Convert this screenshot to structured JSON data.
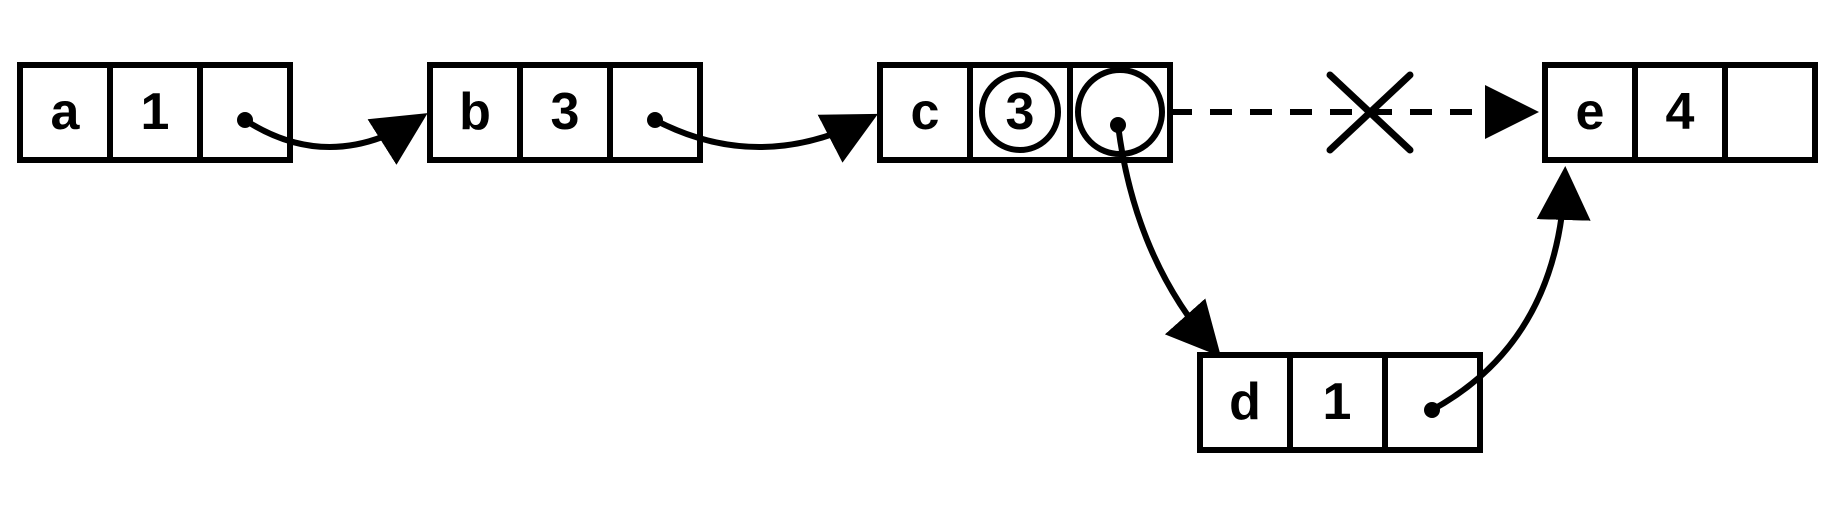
{
  "chart_data": {
    "type": "diagram",
    "description": "Singly linked list with an insertion: original link c→e is cancelled (dashed, crossed out) and replaced by c→d→e. Cells whose value/pointer changed (node c) are circled.",
    "nodes": [
      {
        "id": "a",
        "key": "a",
        "value": "1",
        "next": "b",
        "row": 0
      },
      {
        "id": "b",
        "key": "b",
        "value": "3",
        "next": "c",
        "row": 0
      },
      {
        "id": "c",
        "key": "c",
        "value": "3",
        "next": "d",
        "row": 0,
        "value_changed": true,
        "pointer_changed": true,
        "old_next": "e"
      },
      {
        "id": "d",
        "key": "d",
        "value": "1",
        "next": "e",
        "row": 1
      },
      {
        "id": "e",
        "key": "e",
        "value": "4",
        "next": null,
        "row": 0
      }
    ],
    "cancelled_links": [
      {
        "from": "c",
        "to": "e"
      }
    ]
  },
  "nodes": {
    "a": {
      "key": "a",
      "value": "1"
    },
    "b": {
      "key": "b",
      "value": "3"
    },
    "c": {
      "key": "c",
      "value": "3"
    },
    "d": {
      "key": "d",
      "value": "1"
    },
    "e": {
      "key": "e",
      "value": "4"
    }
  }
}
